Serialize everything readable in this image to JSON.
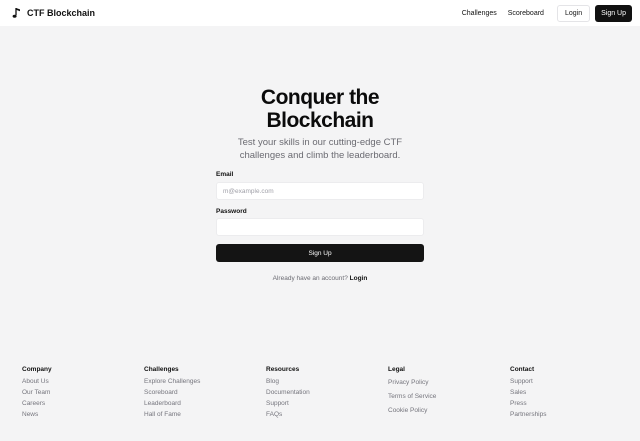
{
  "navbar": {
    "brand_name": "CTF Blockchain",
    "brand_icon": "music-note-icon",
    "links": [
      "Challenges",
      "Scoreboard"
    ],
    "login_label": "Login",
    "signup_label": "Sign Up"
  },
  "hero": {
    "title_line1": "Conquer the",
    "title_line2": "Blockchain",
    "subtitle_line1": "Test your skills in our cutting-edge CTF",
    "subtitle_line2": "challenges and climb the leaderboard."
  },
  "form": {
    "email_label": "Email",
    "email_placeholder": "m@example.com",
    "email_value": "",
    "password_label": "Password",
    "password_value": "",
    "submit_label": "Sign Up",
    "login_prompt": "Already have an account?",
    "login_link": "Login"
  },
  "footer": {
    "columns": [
      {
        "heading": "Company",
        "items": [
          "About Us",
          "Our Team",
          "Careers",
          "News"
        ]
      },
      {
        "heading": "Challenges",
        "items": [
          "Explore Challenges",
          "Scoreboard",
          "Leaderboard",
          "Hall of Fame"
        ]
      },
      {
        "heading": "Resources",
        "items": [
          "Blog",
          "Documentation",
          "Support",
          "FAQs"
        ]
      },
      {
        "heading": "Legal",
        "items": [
          "Privacy Policy",
          "Terms of Service",
          "Cookie Policy"
        ]
      },
      {
        "heading": "Contact",
        "items": [
          "Support",
          "Sales",
          "Press",
          "Partnerships"
        ]
      }
    ]
  },
  "colors": {
    "background": "#f4f4f5",
    "primary_button": "#141414",
    "muted_text": "#6b6b72"
  }
}
